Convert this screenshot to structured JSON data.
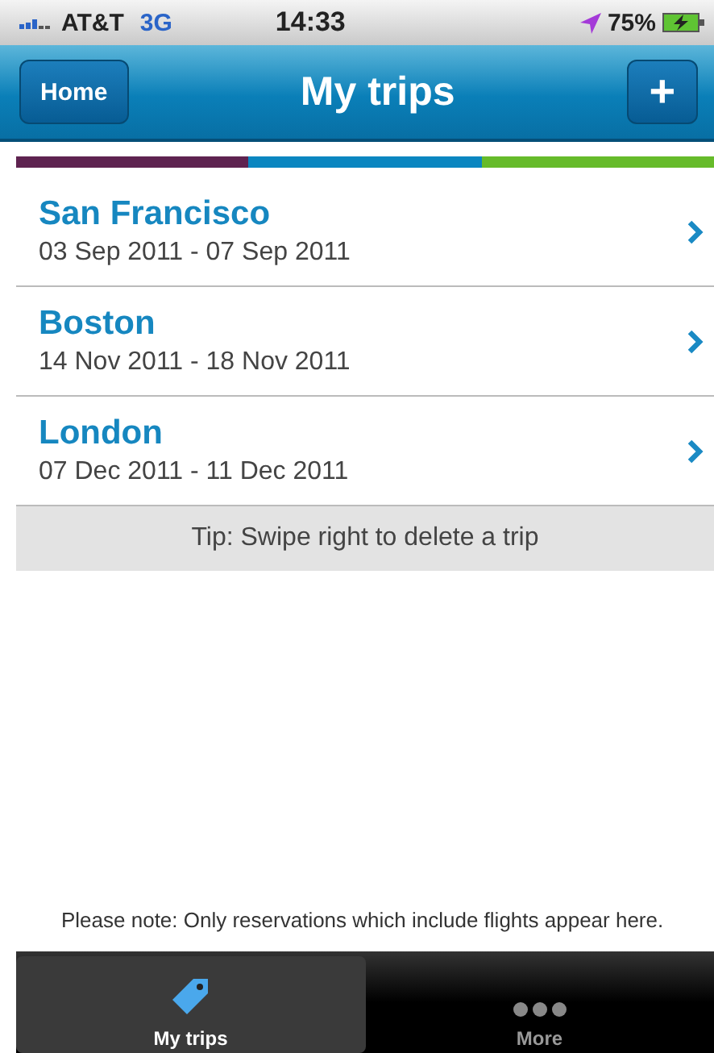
{
  "status_bar": {
    "carrier": "AT&T",
    "network": "3G",
    "time": "14:33",
    "battery": "75%"
  },
  "nav_bar": {
    "back_button": "Home",
    "title": "My trips",
    "add_button": "+"
  },
  "stripe": [
    {
      "color": "#5e2350"
    },
    {
      "color": "#0a86c0"
    },
    {
      "color": "#66bb2a"
    }
  ],
  "trips": [
    {
      "city": "San Francisco",
      "dates": "03 Sep 2011 - 07 Sep 2011"
    },
    {
      "city": "Boston",
      "dates": "14 Nov 2011 - 18 Nov 2011"
    },
    {
      "city": "London",
      "dates": "07 Dec 2011 - 11 Dec 2011"
    }
  ],
  "tip": "Tip: Swipe right to delete a trip",
  "note": "Please note: Only reservations which include flights appear here.",
  "tab_bar": [
    {
      "label": "My trips",
      "kind": "tag",
      "selected": true
    },
    {
      "label": "More",
      "kind": "more",
      "selected": false
    }
  ]
}
